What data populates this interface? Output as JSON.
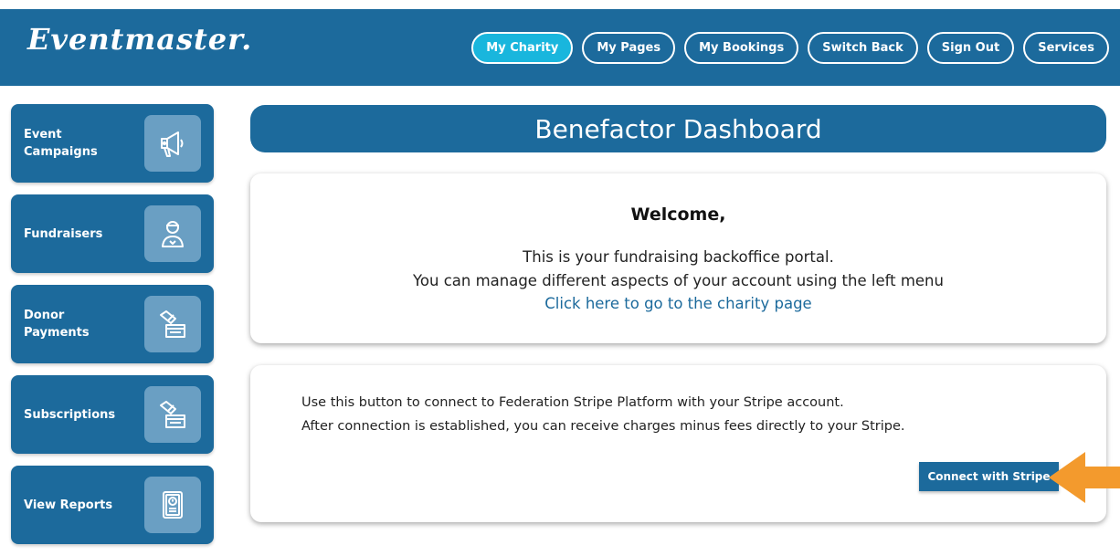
{
  "header": {
    "logo": "Eventmaster.",
    "nav": [
      {
        "label": "My Charity",
        "active": true
      },
      {
        "label": "My Pages",
        "active": false
      },
      {
        "label": "My Bookings",
        "active": false
      },
      {
        "label": "Switch Back",
        "active": false
      },
      {
        "label": "Sign Out",
        "active": false
      },
      {
        "label": "Services",
        "active": false
      }
    ]
  },
  "sidebar": {
    "items": [
      {
        "label": "Event\nCampaigns",
        "icon": "megaphone-icon"
      },
      {
        "label": "Fundraisers",
        "icon": "fundraiser-person-icon"
      },
      {
        "label": "Donor\nPayments",
        "icon": "donation-box-icon"
      },
      {
        "label": "Subscriptions",
        "icon": "donation-box-icon"
      },
      {
        "label": "View Reports",
        "icon": "report-document-icon"
      }
    ]
  },
  "main": {
    "title": "Benefactor Dashboard",
    "welcome": {
      "heading": "Welcome,",
      "line1": "This is your fundraising backoffice portal.",
      "line2": "You can manage different aspects of your account using the left menu",
      "link": "Click here to go to the charity page"
    },
    "stripe": {
      "line1": "Use this button to connect to Federation Stripe Platform with your Stripe account.",
      "line2": "After connection is established, you can receive charges minus fees directly to your Stripe.",
      "button": "Connect with Stripe"
    }
  },
  "colors": {
    "primary": "#1c6a9c",
    "active_nav": "#19b6dd",
    "icon_tile": "#6a9fc3",
    "arrow": "#f39a2d"
  }
}
